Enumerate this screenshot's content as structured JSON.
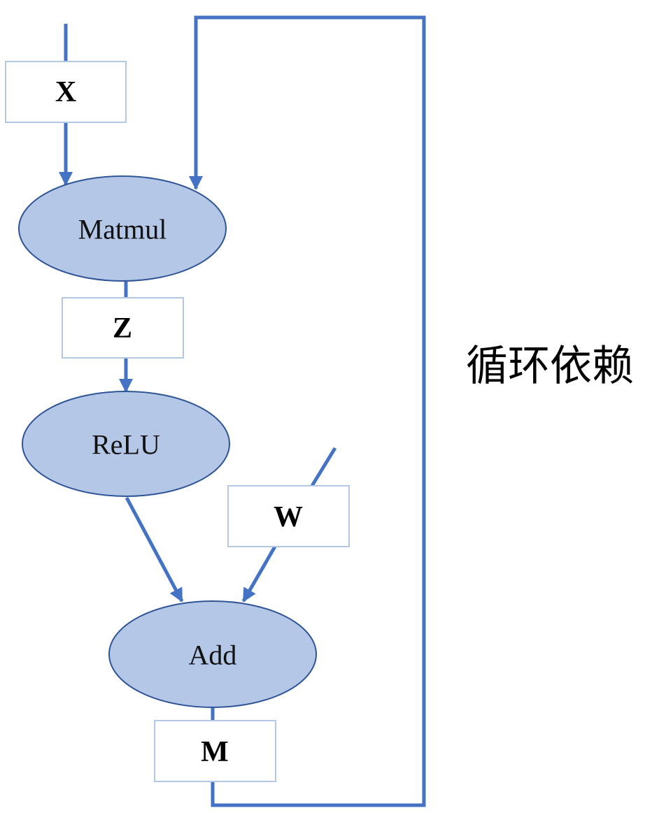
{
  "diagram": {
    "tensors": {
      "x": "X",
      "z": "Z",
      "w": "W",
      "m": "M"
    },
    "operators": {
      "matmul": "Matmul",
      "relu": "ReLU",
      "add": "Add"
    },
    "annotation": "循环依赖",
    "colors": {
      "edge": "#4472c4",
      "operator_fill": "#b4c7e7",
      "operator_stroke": "#2f5597",
      "tensor_stroke": "#b4c7e7"
    }
  }
}
